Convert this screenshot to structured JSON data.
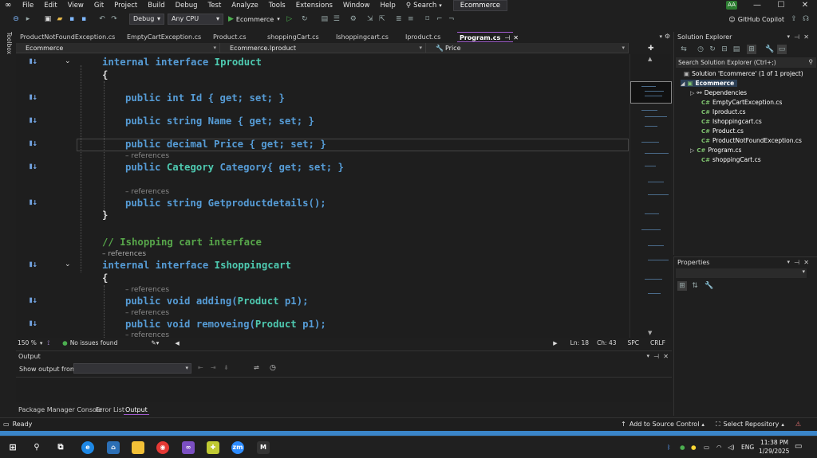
{
  "menu": {
    "items": [
      "File",
      "Edit",
      "View",
      "Git",
      "Project",
      "Build",
      "Debug",
      "Test",
      "Analyze",
      "Tools",
      "Extensions",
      "Window",
      "Help"
    ],
    "search": "Search",
    "solution_title": "Ecommerce",
    "avatar": "AA",
    "copilot": "GitHub Copilot"
  },
  "toolbar": {
    "config": "Debug",
    "platform": "Any CPU",
    "start": "Ecommerce"
  },
  "toolbox_label": "Toolbox",
  "tabs": [
    {
      "label": "ProductNotFoundException.cs"
    },
    {
      "label": "EmptyCartException.cs"
    },
    {
      "label": "Product.cs"
    },
    {
      "label": "shoppingCart.cs"
    },
    {
      "label": "Ishoppingcart.cs"
    },
    {
      "label": "Iproduct.cs"
    },
    {
      "label": "Program.cs"
    }
  ],
  "navbar": {
    "project": "Ecommerce",
    "type": "Ecommerce.Iproduct",
    "member": "Price"
  },
  "code": {
    "l1_kw": "internal interface",
    "l1_name": "Iproduct",
    "brace_open": "{",
    "brace_close": "}",
    "l3": "public int Id { get; set; }",
    "l4": "public string Name { get; set; }",
    "l5_a": "public decimal Price ",
    "l5_b": "{ get; set; }",
    "l6_ref": "– references",
    "l6_a": "public ",
    "l6_b": "Category",
    "l6_c": " Category{ get; set; }",
    "l7_ref": "– references",
    "l7": "public string Getproductdetails();",
    "comment": "// Ishopping cart interface",
    "l9_ref": "– references",
    "l9_name": "Ishoppingcart",
    "l11_ref": "– references",
    "l11_a": "public void adding(",
    "l11_b": "Product",
    "l11_c": " p1);",
    "l12_ref": "– references",
    "l12_a": "public void removeing(",
    "l12_b": "Product",
    "l12_c": " p1);",
    "l13_ref": "– references"
  },
  "editor_status": {
    "zoom": "150 %",
    "issues": "No issues found",
    "ln": "Ln: 18",
    "ch": "Ch: 43",
    "spc": "SPC",
    "crlf": "CRLF"
  },
  "output": {
    "title": "Output",
    "show_from": "Show output from:",
    "tabs": [
      "Package Manager Console",
      "Error List",
      "Output"
    ]
  },
  "solution_explorer": {
    "title": "Solution Explorer",
    "search_placeholder": "Search Solution Explorer (Ctrl+;)",
    "solution": "Solution 'Ecommerce' (1 of 1 project)",
    "project": "Ecommerce",
    "dependencies": "Dependencies",
    "files": [
      "EmptyCartException.cs",
      "Iproduct.cs",
      "Ishoppingcart.cs",
      "Product.cs",
      "ProductNotFoundException.cs",
      "Program.cs",
      "shoppingCart.cs"
    ],
    "cs_badge": "C#"
  },
  "properties": {
    "title": "Properties"
  },
  "statusbar": {
    "ready": "Ready",
    "source_control": "Add to Source Control",
    "repo": "Select Repository"
  },
  "taskbar": {
    "lang": "ENG",
    "time": "11:38 PM",
    "date": "1/29/2025",
    "zoom_label": "zm",
    "m_label": "M"
  }
}
